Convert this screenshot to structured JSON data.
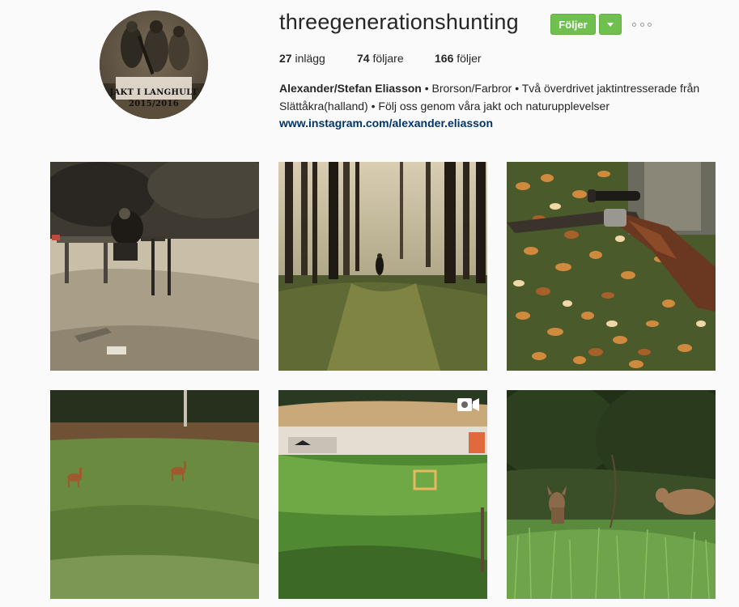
{
  "profile": {
    "username": "threegenerationshunting",
    "avatar_icon": "profile-photo",
    "avatar_text_line1": "JAKT I LANGHULT",
    "avatar_text_line2": "2015/2016"
  },
  "actions": {
    "follow_label": "Följer",
    "follow_color": "#70c050",
    "dropdown_icon": "chevron-down-icon",
    "options_icon": "more-options-icon"
  },
  "stats": {
    "posts_count": "27",
    "posts_label": "inlägg",
    "followers_count": "74",
    "followers_label": "följare",
    "following_count": "166",
    "following_label": "följer"
  },
  "bio": {
    "name": "Alexander/Stefan Eliasson",
    "text": " • Brorson/Farbror • Två överdrivet jaktintresserade från Slättåkra(halland) • Följ oss genom våra jakt och naturupplevelser",
    "link": "www.instagram.com/alexander.eliasson",
    "link_color": "#003569"
  },
  "posts": [
    {
      "name": "post-shooting-range-sepia",
      "type": "photo"
    },
    {
      "name": "post-forest-hunter",
      "type": "photo"
    },
    {
      "name": "post-rifle-on-leaves",
      "type": "photo"
    },
    {
      "name": "post-deer-in-field",
      "type": "photo"
    },
    {
      "name": "post-target-range",
      "type": "video",
      "badge_icon": "video-camera-icon"
    },
    {
      "name": "post-deer-in-grass",
      "type": "photo"
    }
  ]
}
